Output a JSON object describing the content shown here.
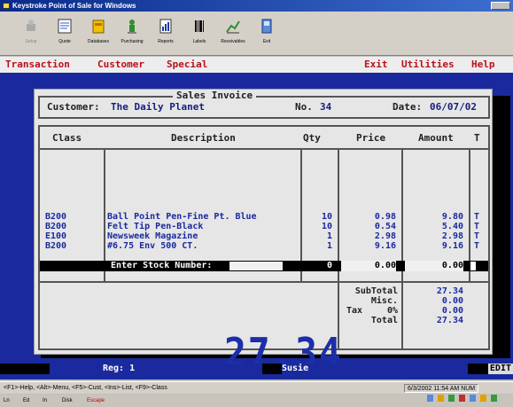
{
  "window": {
    "title": "Keystroke Point of Sale for Windows"
  },
  "toolbar": {
    "buttons": [
      {
        "label": "Setup",
        "icon": "setup-icon",
        "enabled": false
      },
      {
        "label": "Quote",
        "icon": "quote-icon",
        "enabled": true
      },
      {
        "label": "Databases",
        "icon": "databases-icon",
        "enabled": true
      },
      {
        "label": "Purchasing",
        "icon": "purchasing-icon",
        "enabled": true
      },
      {
        "label": "Reports",
        "icon": "reports-icon",
        "enabled": true
      },
      {
        "label": "Labels",
        "icon": "labels-icon",
        "enabled": true
      },
      {
        "label": "Receivables",
        "icon": "receivables-icon",
        "enabled": true
      },
      {
        "label": "Exit",
        "icon": "exit-icon",
        "enabled": true
      }
    ]
  },
  "menu": {
    "transaction": "Transaction",
    "customer": "Customer",
    "special": "Special",
    "exit": "Exit",
    "utilities": "Utilities",
    "help": "Help"
  },
  "invoice": {
    "title": "Sales Invoice",
    "customer_label": "Customer:",
    "customer_name": "The Daily Planet",
    "number_label": "No.",
    "number": "34",
    "date_label": "Date:",
    "date": "06/07/02"
  },
  "columns": {
    "class": "Class",
    "description": "Description",
    "qty": "Qty",
    "price": "Price",
    "amount": "Amount",
    "tax": "T"
  },
  "lines": [
    {
      "class": "B200",
      "description": "Ball Point Pen-Fine Pt. Blue",
      "qty": "10",
      "price": "0.98",
      "amount": "9.80",
      "tax": "T"
    },
    {
      "class": "B200",
      "description": "Felt Tip Pen-Black",
      "qty": "10",
      "price": "0.54",
      "amount": "5.40",
      "tax": "T"
    },
    {
      "class": "E100",
      "description": "Newsweek Magazine",
      "qty": "1",
      "price": "2.98",
      "amount": "2.98",
      "tax": "T"
    },
    {
      "class": "B200",
      "description": "#6.75 Env 500 CT.",
      "qty": "1",
      "price": "9.16",
      "amount": "9.16",
      "tax": "T"
    }
  ],
  "entry": {
    "prompt": "Enter Stock Number:",
    "value": "",
    "qty": "0",
    "price": "0.00",
    "amount": "0.00"
  },
  "totals": {
    "big_total": "27.34",
    "subtotal_label": "SubTotal",
    "subtotal": "27.34",
    "misc_label": "Misc.",
    "misc": "0.00",
    "tax_label": "Tax",
    "tax_rate": "0%",
    "tax": "0.00",
    "total_label": "Total",
    "total": "27.34"
  },
  "status": {
    "register": "Reg: 1",
    "user": "Susie",
    "mode": "EDIT"
  },
  "hint_bar": {
    "text": "<F1>-Help, <Alt>-Menu, <F5>-Cust, <Ins>-List, <F9>-Class",
    "datetime": "6/3/2002 11:54 AM  NUM"
  },
  "taskbar": {
    "items": [
      "Ln",
      "Ed",
      "In",
      "Disk",
      "Escape"
    ]
  }
}
